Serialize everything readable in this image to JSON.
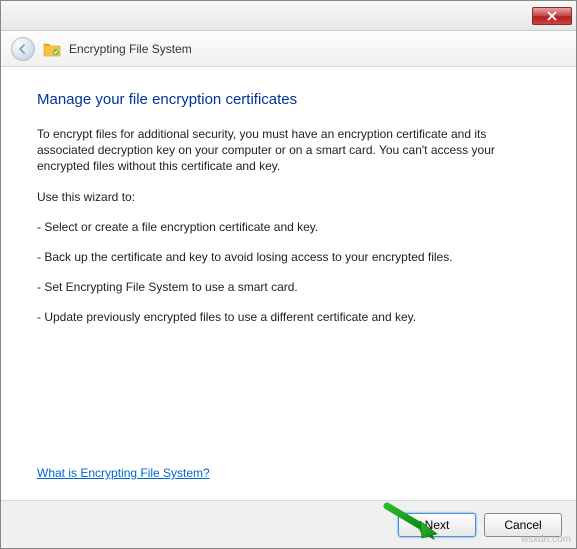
{
  "window": {
    "title": "Encrypting File System"
  },
  "content": {
    "heading": "Manage your file encryption certificates",
    "intro": "To encrypt files for additional security, you must have an encryption certificate and its associated decryption key on your computer or on a smart card. You can't access your encrypted files without this certificate and key.",
    "use_wizard": "Use this wizard to:",
    "items": [
      "- Select or create a file encryption certificate and key.",
      "- Back up the certificate and key to avoid losing access to your encrypted files.",
      "- Set Encrypting File System to use a smart card.",
      "- Update previously encrypted files to use a different certificate and key."
    ],
    "help_link": "What is Encrypting File System?"
  },
  "footer": {
    "next": "Next",
    "cancel": "Cancel"
  },
  "watermark": "wsxdn.com"
}
